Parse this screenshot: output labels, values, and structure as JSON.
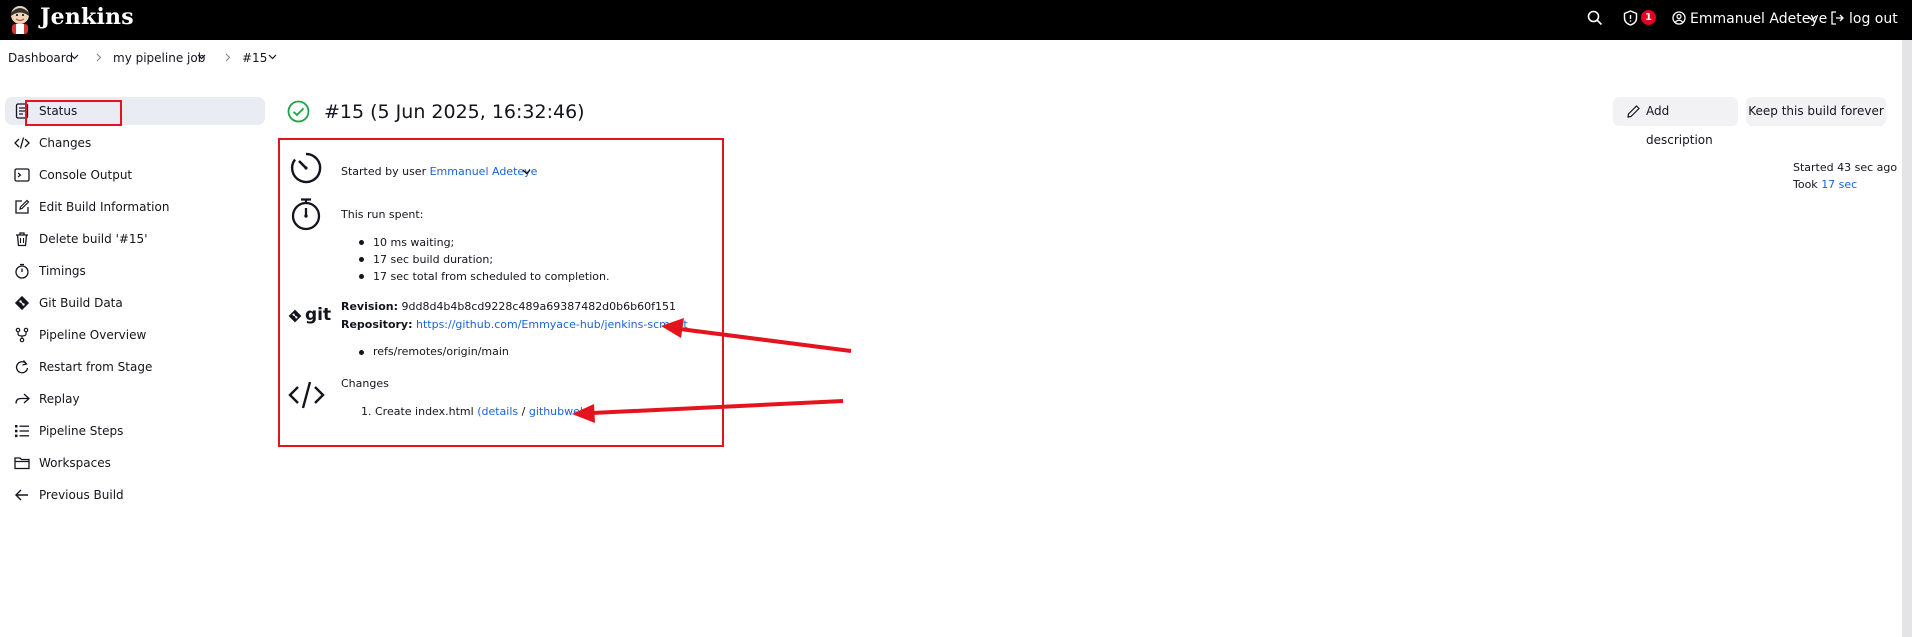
{
  "header": {
    "brand": "Jenkins",
    "security_count": "1",
    "user_name": "Emmanuel Adeteye",
    "logout_label": "log out"
  },
  "breadcrumb": {
    "items": [
      "Dashboard",
      "my pipeline job",
      "#15"
    ]
  },
  "sidebar": {
    "items": [
      {
        "label": "Status",
        "icon": "document-icon"
      },
      {
        "label": "Changes",
        "icon": "code-icon"
      },
      {
        "label": "Console Output",
        "icon": "terminal-icon"
      },
      {
        "label": "Edit Build Information",
        "icon": "edit-icon"
      },
      {
        "label": "Delete build '#15'",
        "icon": "trash-icon"
      },
      {
        "label": "Timings",
        "icon": "stopwatch-icon"
      },
      {
        "label": "Git Build Data",
        "icon": "git-icon"
      },
      {
        "label": "Pipeline Overview",
        "icon": "branch-icon"
      },
      {
        "label": "Restart from Stage",
        "icon": "restart-icon"
      },
      {
        "label": "Replay",
        "icon": "replay-icon"
      },
      {
        "label": "Pipeline Steps",
        "icon": "list-icon"
      },
      {
        "label": "Workspaces",
        "icon": "folder-icon"
      },
      {
        "label": "Previous Build",
        "icon": "arrow-left-icon"
      }
    ]
  },
  "main": {
    "title": "#15 (5 Jun 2025, 16:32:46)",
    "add_description_label": "Add description",
    "keep_forever_label": "Keep this build forever",
    "started_ago": "Started 43 sec ago",
    "took_label": "Took",
    "took_value": "17 sec",
    "started_by_prefix": "Started by user",
    "started_by_user": "Emmanuel Adeteye",
    "run_spent_label": "This run spent:",
    "run_spent_items": [
      "10 ms waiting;",
      "17 sec build duration;",
      "17 sec total from scheduled to completion."
    ],
    "git_logo_text": "git",
    "revision_label": "Revision:",
    "revision_value": "9dd8d4b4b8cd9228c489a69387482d0b6b60f151",
    "repository_label": "Repository:",
    "repository_url": "https://github.com/Emmyace-hub/jenkins-scm.git",
    "refs_item": "refs/remotes/origin/main",
    "changes_label": "Changes",
    "change_entry": "1. Create index.html",
    "details_link": "details",
    "githubweb_link": "githubweb"
  },
  "colors": {
    "accent": "#1a64d6",
    "success": "#1ea446",
    "annotation_red": "#e4141e",
    "header_bg": "#000000"
  }
}
